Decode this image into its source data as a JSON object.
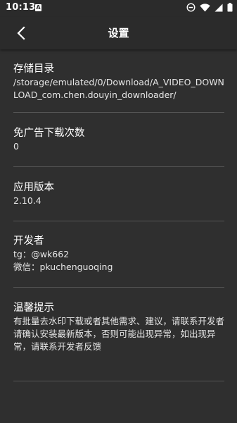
{
  "status_bar": {
    "time": "10:13",
    "app_icon_glyph": "A",
    "icons": [
      "do-not-disturb-icon",
      "wifi-icon",
      "signal-icon",
      "battery-icon"
    ]
  },
  "header": {
    "title": "设置",
    "back_icon": "back-arrow-icon"
  },
  "settings": [
    {
      "title": "存储目录",
      "lines": [
        "/storage/emulated/0/Download/A_VIDEO_DOWNLOAD_com.chen.douyin_downloader/"
      ]
    },
    {
      "title": "免广告下载次数",
      "lines": [
        "0"
      ]
    },
    {
      "title": "应用版本",
      "lines": [
        "2.10.4"
      ]
    },
    {
      "title": "开发者",
      "lines": [
        "tg：@wk662",
        "微信：pkuchenguoqing"
      ]
    },
    {
      "title": "温馨提示",
      "lines": [
        "有批量去水印下载或者其他需求、建议，请联系开发者",
        "请确认安装最新版本，否则可能出现异常，如出现异常，请联系开发者反馈"
      ]
    }
  ],
  "colors": {
    "background": "#2f2f2f",
    "app_bar": "#2b2b2b",
    "divider": "#555555",
    "text": "#ffffff"
  }
}
